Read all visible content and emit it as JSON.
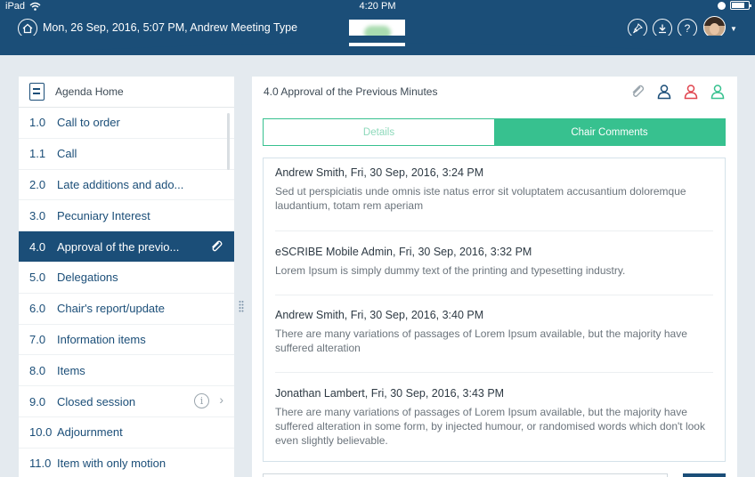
{
  "status_bar": {
    "device": "iPad",
    "time": "4:20 PM",
    "battery_level": 0.8
  },
  "header": {
    "title": "Mon, 26 Sep, 2016, 5:07 PM, Andrew Meeting Type",
    "icons": [
      "home-icon",
      "pin-icon",
      "download-icon",
      "help-icon"
    ]
  },
  "sidebar": {
    "home_label": "Agenda Home",
    "items": [
      {
        "num": "1.0",
        "label": "Call to order"
      },
      {
        "num": "1.1",
        "label": "Call"
      },
      {
        "num": "2.0",
        "label": "Late additions and ado..."
      },
      {
        "num": "3.0",
        "label": "Pecuniary Interest"
      },
      {
        "num": "4.0",
        "label": "Approval of the previo...",
        "active": true
      },
      {
        "num": "5.0",
        "label": "Delegations"
      },
      {
        "num": "6.0",
        "label": "Chair's report/update"
      },
      {
        "num": "7.0",
        "label": "Information items"
      },
      {
        "num": "8.0",
        "label": "Items"
      },
      {
        "num": "9.0",
        "label": "Closed session"
      },
      {
        "num": "10.0",
        "label": "Adjournment"
      },
      {
        "num": "11.0",
        "label": "Item with only motion"
      }
    ]
  },
  "main": {
    "title": "4.0 Approval of the Previous Minutes",
    "tabs": {
      "details": "Details",
      "chair_comments": "Chair Comments"
    },
    "comments": [
      {
        "author": "Andrew Smith, Fri, 30 Sep, 2016, 3:24 PM",
        "body": "Sed ut perspiciatis unde omnis iste natus error sit voluptatem accusantium doloremque laudantium, totam rem aperiam"
      },
      {
        "author": "eSCRIBE Mobile Admin, Fri, 30 Sep, 2016, 3:32 PM",
        "body": "Lorem Ipsum is simply dummy text of the printing and typesetting industry."
      },
      {
        "author": "Andrew Smith, Fri, 30 Sep, 2016, 3:40 PM",
        "body": "There are many variations of passages of Lorem Ipsum available, but the majority have suffered alteration"
      },
      {
        "author": "Jonathan Lambert, Fri, 30 Sep, 2016, 3:43 PM",
        "body": "There are many variations of passages of Lorem Ipsum available, but the majority have suffered alteration in some form, by injected humour, or randomised words which don't look even slightly believable."
      }
    ]
  },
  "colors": {
    "header_bg": "#1b4e78",
    "accent_green": "#37c18f",
    "person_blue": "#1b4e78",
    "person_red": "#e0454f",
    "person_green": "#37c18f"
  }
}
